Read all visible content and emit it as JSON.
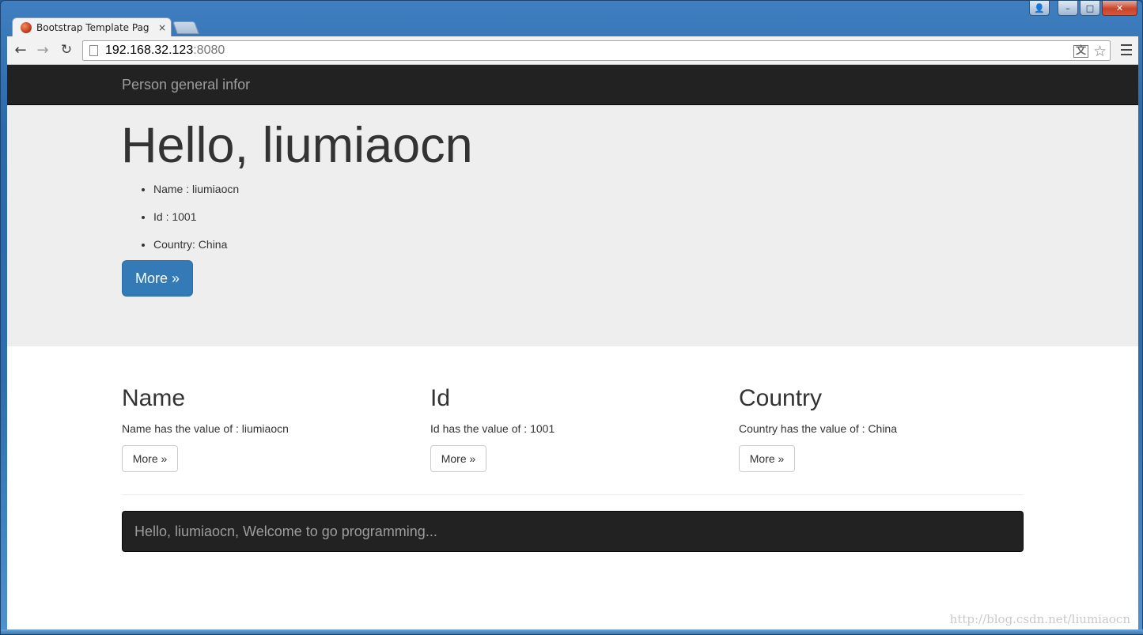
{
  "browser": {
    "tab_title": "Bootstrap Template Pag",
    "tab_close": "×",
    "url_host": "192.168.32.123",
    "url_port": ":8080",
    "back_icon": "←",
    "forward_icon": "→",
    "reload_icon": "↻",
    "translate_icon": "文",
    "star_icon": "☆"
  },
  "window": {
    "min": "–",
    "max": "□",
    "close": "✕",
    "user": "👤"
  },
  "page": {
    "brand": "Person general infor",
    "heading": "Hello, liumiaocn",
    "info": [
      "Name : liumiaocn",
      "Id : 1001",
      "Country: China"
    ],
    "primary_button": "More »",
    "columns": [
      {
        "title": "Name",
        "text": "Name has the value of : liumiaocn",
        "button": "More »"
      },
      {
        "title": "Id",
        "text": "Id has the value of : 1001",
        "button": "More »"
      },
      {
        "title": "Country",
        "text": "Country has the value of : China",
        "button": "More »"
      }
    ],
    "footer": "Hello, liumiaocn, Welcome to go programming...",
    "watermark": "http://blog.csdn.net/liumiaocn"
  },
  "colors": {
    "navbar": "#222222",
    "jumbotron": "#eeeeee",
    "primary": "#337ab7"
  }
}
